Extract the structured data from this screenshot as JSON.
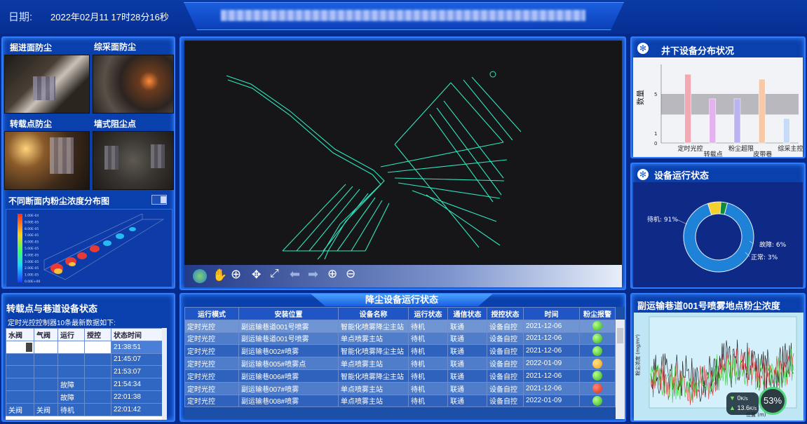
{
  "header": {
    "date_label": "日期:",
    "datetime": "2022年02月11 17时28分16秒",
    "title_placeholder": "obscured system title"
  },
  "left": {
    "cam_titles": [
      "掘进面防尘",
      "综采面防尘",
      "转载点防尘",
      "墙式阻尘点"
    ],
    "dust_section_title": "不同断面内粉尘浓度分布图",
    "legend_ticks": [
      "1.00E-04",
      "9.00E-05",
      "8.00E-05",
      "7.00E-05",
      "6.00E-05",
      "5.00E-05",
      "4.00E-05",
      "3.00E-05",
      "2.00E-05",
      "1.00E-05",
      "0.00E+00"
    ]
  },
  "transfer": {
    "title": "转载点与巷道设备状态",
    "subtitle": "定时光控控制器10条最新数据如下:",
    "headers": [
      "水阀",
      "气阀",
      "运行",
      "receptor",
      "状态时间"
    ],
    "rows": [
      [
        "",
        "",
        "",
        "",
        "21:38:51"
      ],
      [
        "",
        "",
        "",
        "",
        "21:45:07"
      ],
      [
        "",
        "",
        "",
        "",
        "21:53:07"
      ],
      [
        "",
        "",
        "故障",
        "",
        "21:54:34"
      ],
      [
        "",
        "",
        "故障",
        "",
        "22:01:38"
      ],
      [
        "关阀",
        "关阀",
        "待机",
        "",
        "22:01:42"
      ]
    ]
  },
  "map": {
    "toolbar": [
      "globe-icon",
      "hand-icon",
      "zoom-select-icon",
      "shrink-icon",
      "expand-icon",
      "back-icon",
      "forward-icon",
      "zoom-in-icon",
      "zoom-out-icon"
    ]
  },
  "dust_table": {
    "title": "降尘设备运行状态",
    "headers": [
      "运行模式",
      "安装位置",
      "设备名称",
      "运行状态",
      "通信状态",
      "授控状态",
      "时间",
      "粉尘报警"
    ],
    "rows": [
      [
        "定时光控",
        "副运输巷道001号喷雾",
        "智能化喷雾降尘主站",
        "待机",
        "联通",
        "设备自控",
        "2021-12-06",
        "green"
      ],
      [
        "定时光控",
        "副运输巷道001号喷雾",
        "单点喷雾主站",
        "待机",
        "联通",
        "设备自控",
        "2021-12-06",
        "green"
      ],
      [
        "定时光控",
        "副运输巷002#喷雾",
        "智能化喷雾降尘主站",
        "待机",
        "联通",
        "设备自控",
        "2021-12-06",
        "green"
      ],
      [
        "定时光控",
        "副运输巷005#喷雾点",
        "单点喷雾主站",
        "待机",
        "联通",
        "设备自控",
        "2022-01-09",
        "orange"
      ],
      [
        "定时光控",
        "副运输巷006#喷雾",
        "智能化喷雾降尘主站",
        "待机",
        "联通",
        "设备自控",
        "2021-12-06",
        "green"
      ],
      [
        "定时光控",
        "副运输巷007#喷雾",
        "单点喷雾主站",
        "待机",
        "联通",
        "设备自控",
        "2021-12-06",
        "red"
      ],
      [
        "定时光控",
        "副运输巷008#喷雾",
        "单点喷雾主站",
        "待机",
        "联通",
        "设备自控",
        "2022-01-09",
        "green"
      ]
    ]
  },
  "dist": {
    "title": "井下设备分布状况",
    "ylabel": "数量"
  },
  "chart_data": [
    {
      "type": "bar",
      "title": "井下设备分布状况",
      "ylabel": "数量",
      "categories": [
        "定时光控",
        "转载点",
        "粉尘超限",
        "皮带巷",
        "综采主控"
      ],
      "values": [
        7,
        4.5,
        4.5,
        6.5,
        2.5
      ],
      "colors": [
        "#f3a9b4",
        "#e4b2ee",
        "#b9b3f1",
        "#f7c9a8",
        "#c6dbf7"
      ],
      "yticks": [
        "0",
        "1",
        "5"
      ]
    },
    {
      "type": "pie",
      "title": "设备运行状态",
      "labels": [
        "待机: 91%",
        "故障: 6%",
        "正常: 3%"
      ],
      "values": [
        91,
        6,
        3
      ],
      "colors": [
        "#1e82d8",
        "#f4cf2e",
        "#0f8a3a"
      ]
    },
    {
      "type": "line",
      "title": "副运输巷道001号喷雾地点粉尘浓度",
      "ylabel": "粉尘浓度(mg/m³)",
      "xlabel": "位置(m)"
    }
  ],
  "status_card": {
    "title": "设备运行状态"
  },
  "trend": {
    "title": "副运输巷道001号喷雾地点粉尘浓度",
    "ylabel": "粉尘浓度 (mg/m³)",
    "xlabel": "位置 (m)",
    "down": "0",
    "down_unit": "K/s",
    "up": "13.6",
    "up_unit": "K/s",
    "percent": "53%"
  }
}
